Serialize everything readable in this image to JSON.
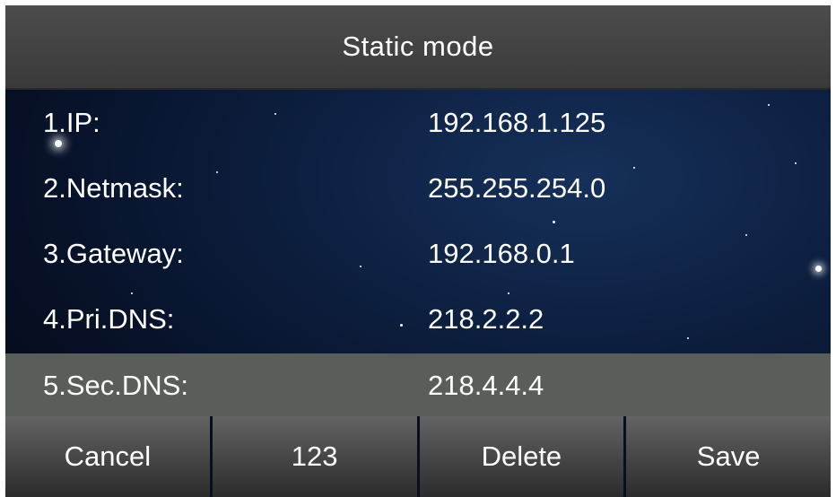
{
  "header": {
    "title": "Static mode"
  },
  "fields": [
    {
      "label": "1.IP:",
      "value": "192.168.1.125"
    },
    {
      "label": "2.Netmask:",
      "value": "255.255.254.0"
    },
    {
      "label": "3.Gateway:",
      "value": "192.168.0.1"
    },
    {
      "label": "4.Pri.DNS:",
      "value": "218.2.2.2"
    },
    {
      "label": "5.Sec.DNS:",
      "value": "218.4.4.4",
      "selected": true
    }
  ],
  "softkeys": {
    "cancel": "Cancel",
    "input_mode": "123",
    "delete": "Delete",
    "save": "Save"
  },
  "colors": {
    "titlebar": "#444444",
    "selected_row": "#5a5e5a",
    "text": "#ffffff"
  }
}
